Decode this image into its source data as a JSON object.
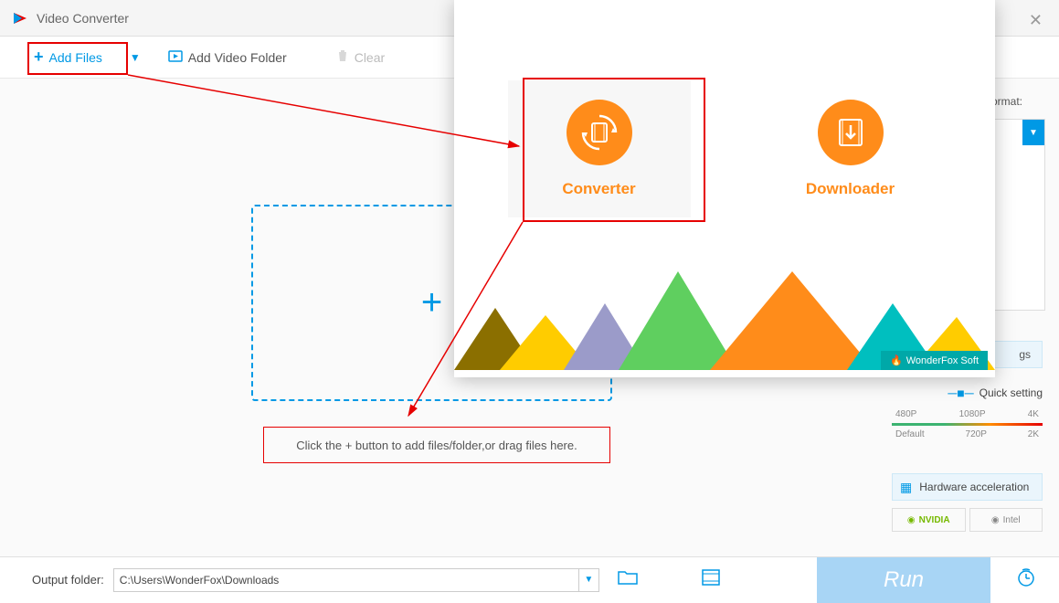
{
  "app": {
    "title": "Video Converter"
  },
  "toolbar": {
    "add_files": "Add Files",
    "add_folder": "Add Video Folder",
    "clear": "Clear"
  },
  "dropzone": {
    "hint": "Click the + button to add files/folder,or drag files here."
  },
  "right": {
    "format_label": "format:",
    "settings": "gs",
    "quick_setting": "Quick setting",
    "res_top": [
      "480P",
      "1080P",
      "4K"
    ],
    "res_bot": [
      "Default",
      "720P",
      "2K"
    ],
    "hw_accel": "Hardware acceleration",
    "nvidia": "NVIDIA",
    "intel": "Intel"
  },
  "bottom": {
    "output_label": "Output folder:",
    "output_path": "C:\\Users\\WonderFox\\Downloads",
    "run": "Run"
  },
  "overlay": {
    "converter": "Converter",
    "downloader": "Downloader",
    "brand": "WonderFox Soft"
  }
}
